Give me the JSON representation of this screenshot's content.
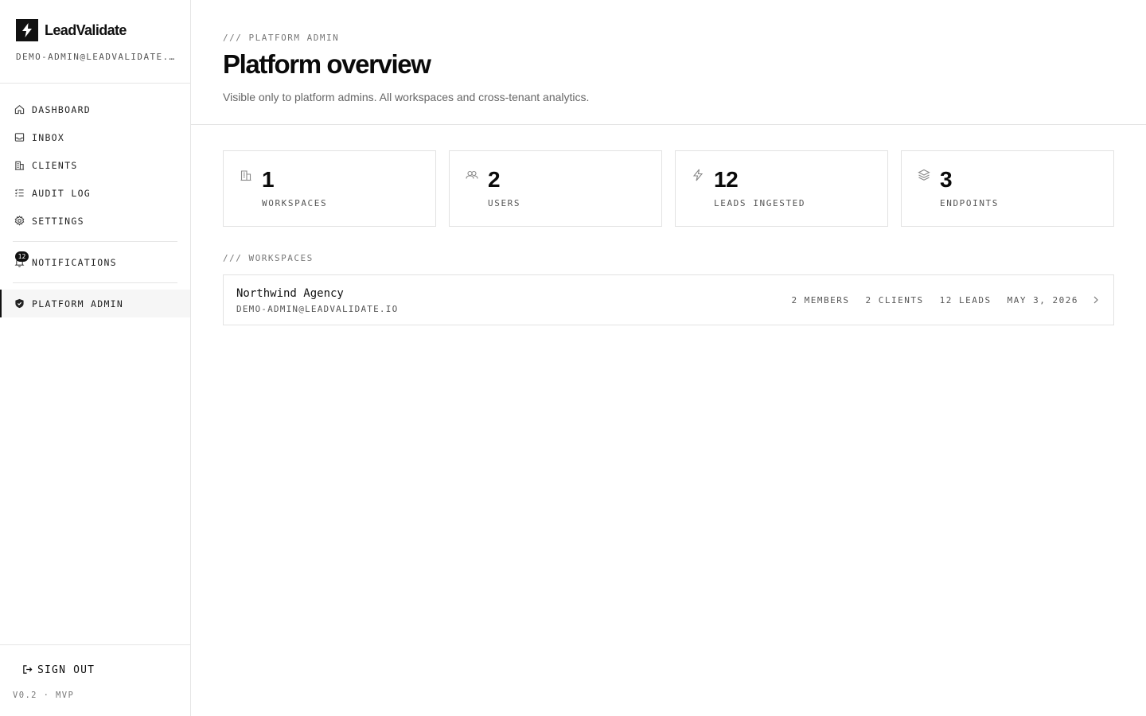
{
  "brand": {
    "name": "LeadValidate",
    "icon": "bolt-icon"
  },
  "account": {
    "email": "DEMO-ADMIN@LEADVALIDATE.IO"
  },
  "nav": {
    "items": [
      {
        "label": "DASHBOARD",
        "icon": "home-icon"
      },
      {
        "label": "INBOX",
        "icon": "inbox-icon"
      },
      {
        "label": "CLIENTS",
        "icon": "building-icon"
      },
      {
        "label": "AUDIT LOG",
        "icon": "list-check-icon"
      },
      {
        "label": "SETTINGS",
        "icon": "gear-icon"
      }
    ],
    "notifications": {
      "label": "NOTIFICATIONS",
      "icon": "bell-icon",
      "count": "12"
    },
    "platform_admin": {
      "label": "PLATFORM ADMIN",
      "icon": "shield-icon",
      "active": true
    }
  },
  "footer": {
    "signout_label": "SIGN OUT",
    "version": "V0.2 · MVP"
  },
  "header": {
    "eyebrow": "/// PLATFORM ADMIN",
    "title": "Platform overview",
    "subtitle": "Visible only to platform admins. All workspaces and cross-tenant analytics."
  },
  "stats": [
    {
      "value": "1",
      "label": "WORKSPACES",
      "icon": "building-icon"
    },
    {
      "value": "2",
      "label": "USERS",
      "icon": "users-icon"
    },
    {
      "value": "12",
      "label": "LEADS INGESTED",
      "icon": "bolt-icon"
    },
    {
      "value": "3",
      "label": "ENDPOINTS",
      "icon": "layers-icon"
    }
  ],
  "workspaces": {
    "section_label": "/// WORKSPACES",
    "rows": [
      {
        "name": "Northwind Agency",
        "owner": "DEMO-ADMIN@LEADVALIDATE.IO",
        "members": "2 MEMBERS",
        "clients": "2 CLIENTS",
        "leads": "12 LEADS",
        "date": "MAY 3, 2026"
      }
    ]
  },
  "colors": {
    "text": "#111111",
    "muted": "#777777",
    "border": "#e5e5e5",
    "active_bg": "#f6f6f6"
  }
}
